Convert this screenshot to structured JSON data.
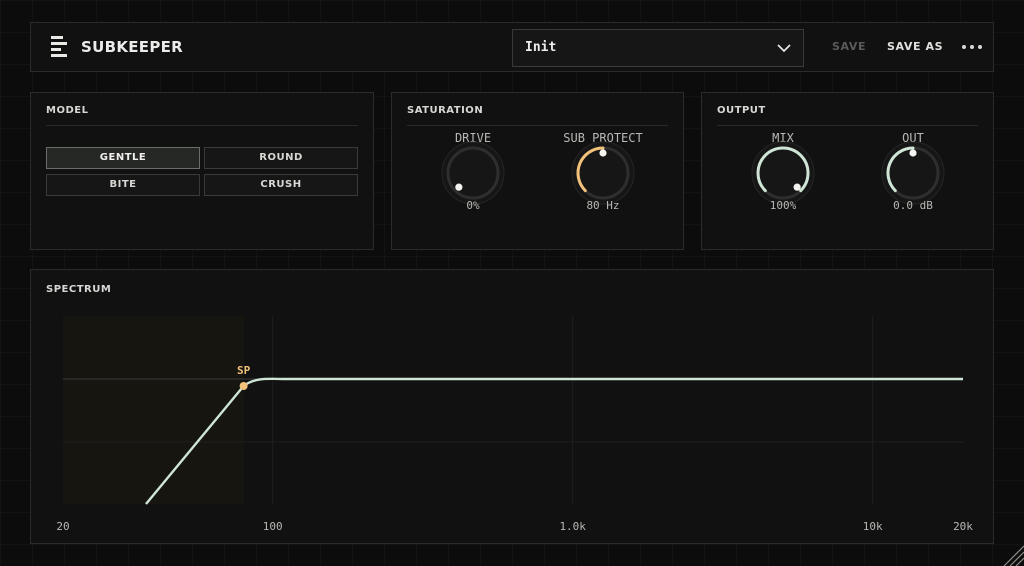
{
  "header": {
    "app_title": "SUBKEEPER",
    "logo_icon": "stacked-bars-logo-icon",
    "preset_name": "Init",
    "save_label": "SAVE",
    "save_as_label": "SAVE AS",
    "more_icon": "more-horizontal-icon"
  },
  "model": {
    "title": "MODEL",
    "options": [
      "GENTLE",
      "ROUND",
      "BITE",
      "CRUSH"
    ],
    "selected": "GENTLE"
  },
  "saturation": {
    "title": "SATURATION",
    "drive": {
      "label": "DRIVE",
      "value_text": "0%",
      "level": 0
    },
    "sub_protect": {
      "label": "SUB PROTECT",
      "value_text": "80 Hz",
      "level": 0.5
    }
  },
  "output": {
    "title": "OUTPUT",
    "mix": {
      "label": "MIX",
      "value_text": "100%",
      "level": 1.0
    },
    "out": {
      "label": "OUT",
      "value_text": "0.0 dB",
      "level": 0.5
    }
  },
  "spectrum": {
    "title": "SPECTRUM",
    "x_ticks": [
      {
        "label": "20",
        "freq": 20
      },
      {
        "label": "100",
        "freq": 100
      },
      {
        "label": "1.0k",
        "freq": 1000
      },
      {
        "label": "10k",
        "freq": 10000
      },
      {
        "label": "20k",
        "freq": 20000
      }
    ],
    "marker_label": "SP",
    "marker_freq": 80,
    "protected_band_hz": [
      20,
      80
    ]
  },
  "colors": {
    "accent_curve": "#cfe6d6",
    "marker": "#f2c27a",
    "text": "#d8d8d4"
  }
}
